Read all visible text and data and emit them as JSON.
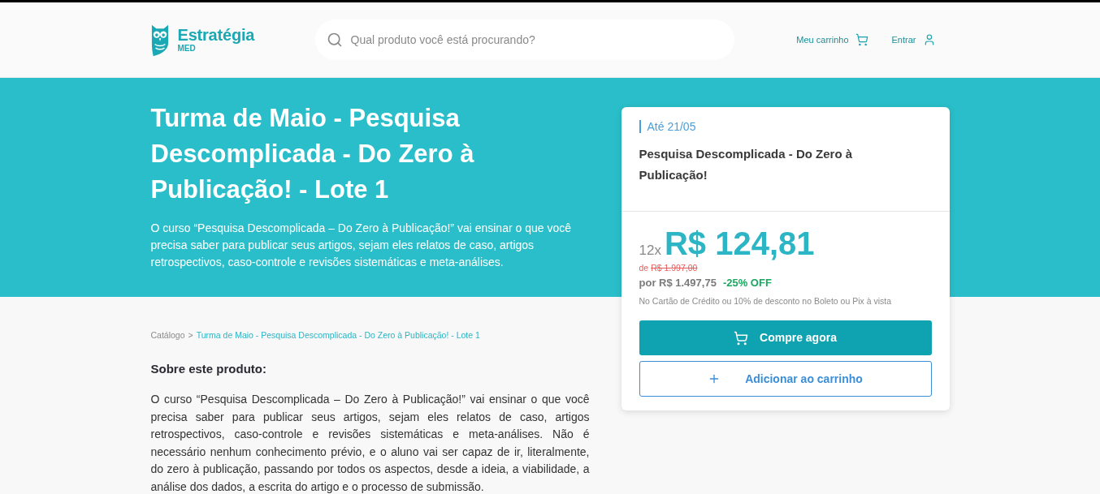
{
  "header": {
    "logo": {
      "name": "Estratégia",
      "sub": "MED"
    },
    "search": {
      "placeholder": "Qual produto você está procurando?"
    },
    "nav": [
      {
        "label": "Meu carrinho",
        "kind": "cart"
      },
      {
        "label": "Entrar",
        "kind": "user"
      }
    ]
  },
  "hero": {
    "title": "Turma de Maio - Pesquisa Descomplicada - Do Zero à Publicação! - Lote 1",
    "description": "O curso “Pesquisa Descomplicada – Do Zero à Publicação!” vai ensinar o que você precisa saber para publicar seus artigos, sejam eles relatos de caso, artigos retrospectivos, caso-controle e revisões sistemáticas e meta-análises."
  },
  "offer_card": {
    "deadline": "Até 21/05",
    "product": "Pesquisa Descomplicada - Do Zero à Publicação!",
    "installments": "12x",
    "installment_price": "R$ 124,81",
    "original_price_label": "de",
    "original_price": "R$ 1.997,00",
    "sale_price": "por R$ 1.497,75",
    "discount": "-25% OFF",
    "payment_note": "No Cartão de Crédito ou 10% de desconto no Boleto ou Pix à vista",
    "buttons": [
      {
        "label": "Compre agora",
        "kind": "primary"
      },
      {
        "label": "Adicionar ao carrinho",
        "kind": "secondary"
      }
    ]
  },
  "breadcrumb": {
    "separator": ">",
    "items": [
      "Catálogo",
      "Turma de Maio - Pesquisa Descomplicada - Do Zero à Publicação! - Lote 1"
    ]
  },
  "about": {
    "heading": "Sobre este produto:",
    "text": "O curso “Pesquisa Descomplicada – Do Zero à Publicação!” vai ensinar o que você precisa saber para publicar seus artigos, sejam eles relatos de caso, artigos retrospectivos, caso-controle e revisões sistemáticas e meta-análises. Não é necessário nenhum conhecimento prévio, e o aluno vai ser capaz de ir, literalmente, do zero à publicação, passando por todos os aspectos, desde a ideia, a viabilidade, a análise dos dados, a escrita do artigo e o processo de submissão."
  }
}
